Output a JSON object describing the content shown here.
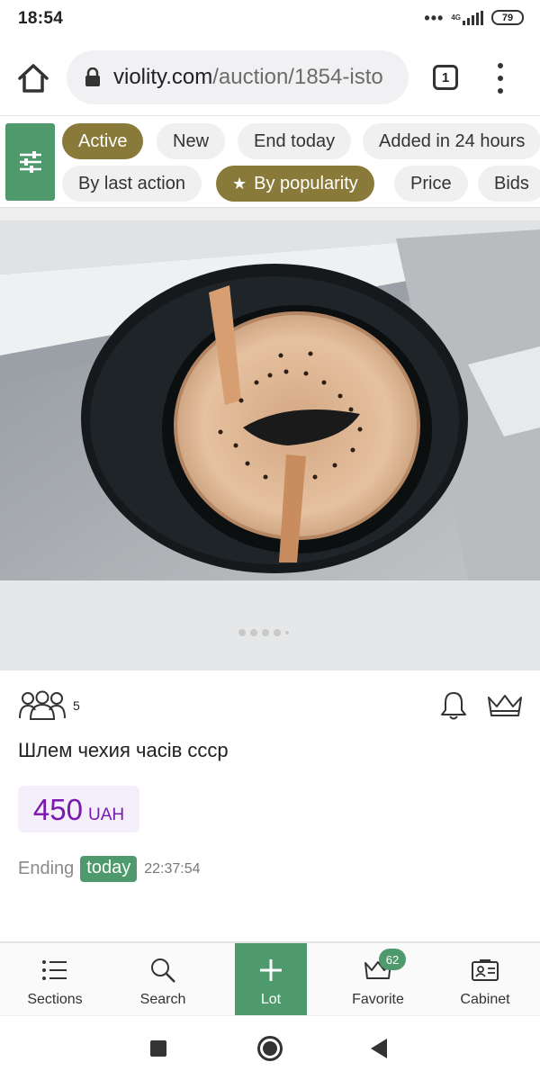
{
  "status_bar": {
    "time": "18:54",
    "network": "4G",
    "battery": "79"
  },
  "browser": {
    "url_domain": "violity.com",
    "url_path": "/auction/1854-isto",
    "tab_count": "1"
  },
  "filters": {
    "row1": [
      {
        "label": "Active",
        "active": true
      },
      {
        "label": "New",
        "active": false
      },
      {
        "label": "End today",
        "active": false
      },
      {
        "label": "Added in 24 hours",
        "active": false
      }
    ],
    "row2": [
      {
        "label": "By last action",
        "active": false
      },
      {
        "label": "By popularity",
        "active": true,
        "icon": "star-icon"
      },
      {
        "label": "Price",
        "active": false
      },
      {
        "label": "Bids",
        "active": false
      }
    ]
  },
  "lot": {
    "bidders_count": "5",
    "title": "Шлем чехия часів ссср",
    "price_value": "450",
    "price_currency": "UAH",
    "ending_label": "Ending",
    "ending_badge": "today",
    "ending_time": "22:37:54"
  },
  "carousel": {
    "total_images": 5,
    "active_index": 0
  },
  "bottom_nav": {
    "items": [
      {
        "label": "Sections",
        "icon": "list-icon"
      },
      {
        "label": "Search",
        "icon": "search-icon"
      },
      {
        "label": "Lot",
        "icon": "plus-icon"
      },
      {
        "label": "Favorite",
        "icon": "crown-icon",
        "badge": "62"
      },
      {
        "label": "Cabinet",
        "icon": "id-card-icon"
      }
    ]
  },
  "colors": {
    "accent_green": "#4f9a6c",
    "active_chip": "#8a7a3a",
    "price_purple": "#7a18b0"
  }
}
